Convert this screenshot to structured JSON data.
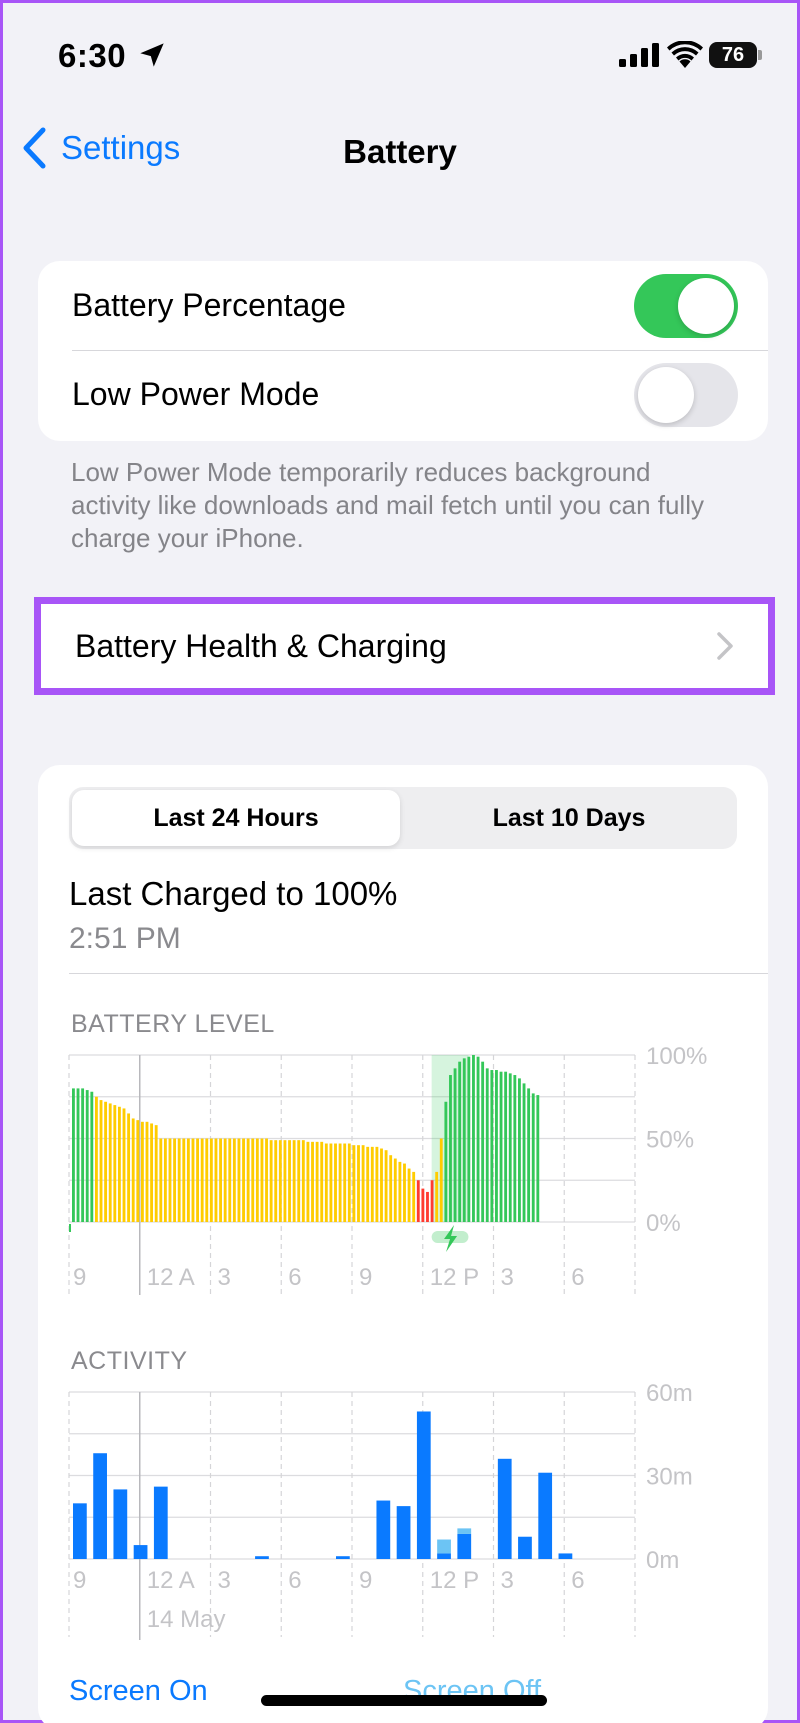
{
  "status_bar": {
    "time": "6:30",
    "battery": "76"
  },
  "nav": {
    "back_label": "Settings",
    "title": "Battery"
  },
  "settings": {
    "battery_percentage": {
      "label": "Battery Percentage",
      "on": true
    },
    "low_power_mode": {
      "label": "Low Power Mode",
      "on": false
    },
    "footnote": "Low Power Mode temporarily reduces background activity like downloads and mail fetch until you can fully charge your iPhone."
  },
  "health": {
    "label": "Battery Health & Charging"
  },
  "usage": {
    "tabs": [
      "Last 24 Hours",
      "Last 10 Days"
    ],
    "selected_tab": 0,
    "last_charged": "Last Charged to 100%",
    "last_charged_time": "2:51 PM",
    "battery_level_label": "BATTERY LEVEL",
    "activity_label": "ACTIVITY",
    "date_label": "14 May",
    "legend": [
      "Screen On",
      "Screen Off"
    ]
  },
  "colors": {
    "accent": "#0a7aff",
    "toggle_on": "#34c759",
    "level_green": "#34c759",
    "level_yellow": "#ffcc00",
    "level_red": "#ff3b30",
    "screen_on": "#0a7aff",
    "screen_off": "#6cc4f4"
  },
  "chart_data": [
    {
      "type": "bar",
      "title": "BATTERY LEVEL",
      "x_tick_labels": [
        "9",
        "12 A",
        "3",
        "6",
        "9",
        "12 P",
        "3",
        "6"
      ],
      "y_tick_labels": [
        "100%",
        "50%",
        "0%"
      ],
      "ylim": [
        0,
        100
      ],
      "unit": "%",
      "levels": [
        80,
        80,
        80,
        79,
        78,
        75,
        73,
        72,
        71,
        70,
        69,
        68,
        65,
        62,
        61,
        60,
        60,
        59,
        58,
        50,
        50,
        50,
        50,
        50,
        50,
        50,
        50,
        50,
        50,
        50,
        50,
        50,
        50,
        50,
        50,
        50,
        50,
        50,
        50,
        50,
        50,
        50,
        50,
        49,
        49,
        49,
        49,
        49,
        49,
        49,
        49,
        48,
        48,
        48,
        48,
        47,
        47,
        47,
        47,
        47,
        47,
        46,
        46,
        46,
        45,
        45,
        45,
        44,
        43,
        40,
        38,
        36,
        35,
        32,
        30,
        25,
        20,
        18,
        25,
        30,
        50,
        72,
        88,
        92,
        96,
        98,
        99,
        100,
        99,
        96,
        92,
        91,
        91,
        90,
        90,
        89,
        88,
        86,
        83,
        80,
        77,
        76
      ],
      "status": [
        "g",
        "g",
        "g",
        "g",
        "g",
        "y",
        "y",
        "y",
        "y",
        "y",
        "y",
        "y",
        "y",
        "y",
        "y",
        "y",
        "y",
        "y",
        "y",
        "y",
        "y",
        "y",
        "y",
        "y",
        "y",
        "y",
        "y",
        "y",
        "y",
        "y",
        "y",
        "y",
        "y",
        "y",
        "y",
        "y",
        "y",
        "y",
        "y",
        "y",
        "y",
        "y",
        "y",
        "y",
        "y",
        "y",
        "y",
        "y",
        "y",
        "y",
        "y",
        "y",
        "y",
        "y",
        "y",
        "y",
        "y",
        "y",
        "y",
        "y",
        "y",
        "y",
        "y",
        "y",
        "y",
        "y",
        "y",
        "y",
        "y",
        "y",
        "y",
        "y",
        "y",
        "y",
        "y",
        "r",
        "r",
        "r",
        "r",
        "y",
        "y",
        "g",
        "g",
        "g",
        "g",
        "g",
        "g",
        "g",
        "g",
        "g",
        "g",
        "g",
        "g",
        "g",
        "g",
        "g",
        "g",
        "g",
        "g",
        "g",
        "g",
        "g"
      ],
      "charging_window": [
        78,
        86
      ]
    },
    {
      "type": "bar",
      "title": "ACTIVITY",
      "x_tick_labels": [
        "9",
        "12 A",
        "3",
        "6",
        "9",
        "12 P",
        "3",
        "6"
      ],
      "y_tick_labels": [
        "60m",
        "30m",
        "0m"
      ],
      "ylim": [
        0,
        60
      ],
      "unit": "minutes",
      "series": [
        {
          "name": "Screen On",
          "values": [
            20,
            38,
            25,
            5,
            26,
            0,
            0,
            0,
            0,
            1,
            0,
            0,
            0,
            1,
            0,
            21,
            19,
            53,
            2,
            9,
            0,
            36,
            8,
            31,
            2,
            0
          ]
        },
        {
          "name": "Screen Off",
          "values": [
            0,
            0,
            0,
            0,
            0,
            0,
            0,
            0,
            0,
            0,
            0,
            0,
            0,
            0,
            0,
            0,
            0,
            0,
            5,
            2,
            0,
            0,
            0,
            0,
            0,
            0
          ]
        }
      ]
    }
  ]
}
